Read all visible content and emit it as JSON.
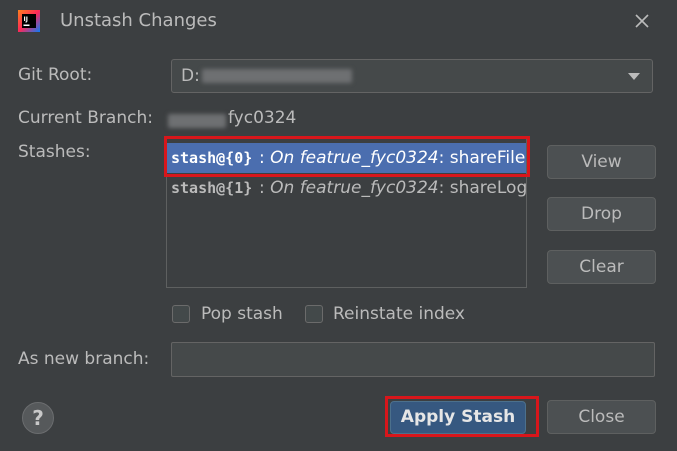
{
  "window": {
    "title": "Unstash Changes",
    "app_icon": "intellij-idea-icon",
    "close_icon": "close-icon"
  },
  "git_root": {
    "label": "Git Root:",
    "value_visible": "D:"
  },
  "current_branch": {
    "label": "Current Branch:",
    "value_visible": "fyc0324"
  },
  "stashes": {
    "label": "Stashes:",
    "items": [
      {
        "ref": "stash@{0}",
        "sep": ": ",
        "message_italic": "On featrue_fyc0324",
        "colon": ":",
        "message_rest": " shareFile",
        "selected": true
      },
      {
        "ref": "stash@{1}",
        "sep": ": ",
        "message_italic": "On featrue_fyc0324",
        "colon": ":",
        "message_rest": " shareLog",
        "selected": false
      }
    ]
  },
  "side_buttons": {
    "view": "View",
    "drop": "Drop",
    "clear": "Clear"
  },
  "options": {
    "pop_stash": {
      "label": "Pop stash",
      "checked": false
    },
    "reinstate_index": {
      "label": "Reinstate index",
      "checked": false
    }
  },
  "new_branch": {
    "label": "As new branch:",
    "value": ""
  },
  "footer": {
    "help": "?",
    "apply": "Apply Stash",
    "close": "Close"
  },
  "colors": {
    "background": "#3c3f41",
    "selection": "#4b6eaf",
    "primary_button": "#365880",
    "highlight_box": "#d8161b"
  }
}
